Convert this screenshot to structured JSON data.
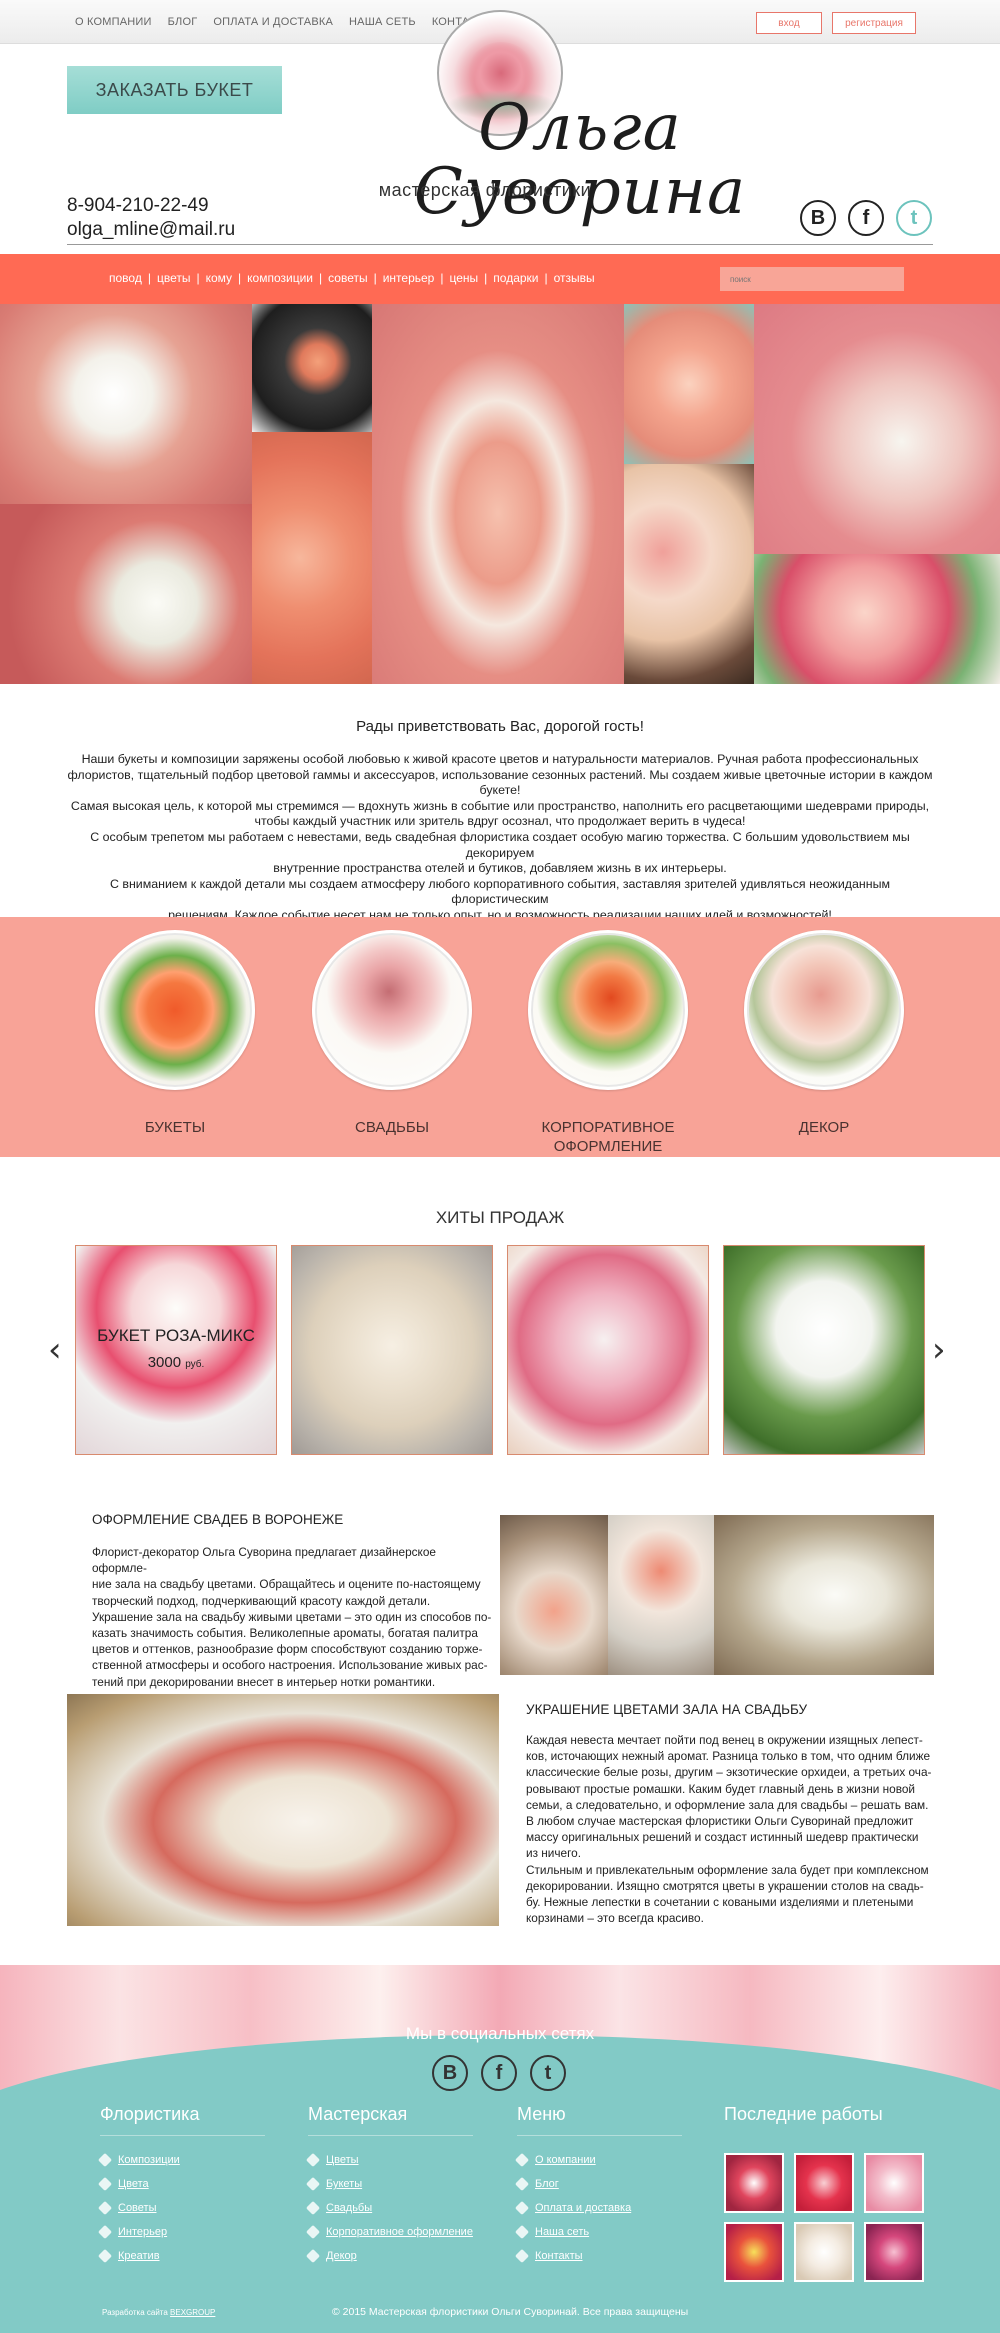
{
  "topnav": [
    "О КОМПАНИИ",
    "БЛОГ",
    "ОПЛАТА И ДОСТАВКА",
    "НАША СЕТЬ",
    "КОНТАКТЫ"
  ],
  "auth": {
    "login": "вход",
    "register": "регистрация"
  },
  "header": {
    "order_button": "ЗАКАЗАТЬ БУКЕТ",
    "logo_name": "Ольга Суворина",
    "logo_sub": "мастерская флористики",
    "phone": "8-904-210-22-49",
    "email": "olga_mline@mail.ru"
  },
  "social": {
    "vk": "В",
    "fb": "f",
    "tw": "t"
  },
  "mainnav": [
    "повод",
    "цветы",
    "кому",
    "композиции",
    "советы",
    "интерьер",
    "цены",
    "подарки",
    "отзывы"
  ],
  "search": {
    "placeholder": "поиск"
  },
  "welcome": {
    "title": "Рады приветствовать Вас, дорогой гость!",
    "lines": [
      "Наши букеты и композиции заряжены особой любовью к живой красоте цветов и натуральности материалов. Ручная работа профессиональных",
      "флористов, тщательный подбор цветовой гаммы и аксессуаров, использование сезонных растений. Мы создаем живые цветочные истории в каждом",
      "букете!",
      "Самая высокая цель, к которой мы стремимся — вдохнуть жизнь в событие или пространство, наполнить его расцветающими шедеврами природы,",
      "чтобы каждый участник или зритель вдруг осознал, что продолжает верить в чудеса!",
      "С особым трепетом мы работаем с невестами, ведь свадебная флористика создает особую магию торжества. С большим удовольствием мы декорируем",
      "внутренние пространства отелей и бутиков, добавляем жизнь в их интерьеры.",
      "С вниманием к каждой детали мы создаем атмосферу любого корпоративного события, заставляя зрителей удивляться неожиданным флористическим",
      "решениям. Каждое событие несет нам не только опыт, но и возможность реализации наших идей и возможностей!"
    ]
  },
  "categories": [
    {
      "label": "БУКЕТЫ"
    },
    {
      "label": "СВАДЬБЫ"
    },
    {
      "label": "КОРПОРАТИВНОЕ ОФОРМЛЕНИЕ"
    },
    {
      "label": "ДЕКОР"
    }
  ],
  "hits": {
    "title": "ХИТЫ ПРОДАЖ",
    "featured_name": "БУКЕТ РОЗА-МИКС",
    "featured_price": "3000",
    "featured_currency": "руб."
  },
  "article1": {
    "title": "ОФОРМЛЕНИЕ СВАДЕБ В ВОРОНЕЖЕ",
    "lines": [
      "Флорист-декоратор Ольга Суворина предлагает дизайнерское оформле-",
      "ние зала на свадьбу цветами. Обращайтесь и оцените по-настоящему",
      "творческий подход, подчеркивающий красоту каждой детали.",
      "Украшение зала на свадьбу живыми цветами – это один из способов по-",
      "казать значимость события. Великолепные ароматы, богатая палитра",
      "цветов и оттенков, разнообразие форм способствуют созданию торже-",
      "ственной атмосферы и особого настроения. Использование живых рас-",
      "тений при декорировании внесет в интерьер нотки романтики."
    ]
  },
  "article2": {
    "title": "УКРАШЕНИЕ ЦВЕТАМИ ЗАЛА НА СВАДЬБУ",
    "lines": [
      "Каждая невеста мечтает пойти под венец в окружении изящных лепест-",
      "ков, источающих нежный аромат. Разница только в том, что одним ближе",
      "классические белые розы, другим – экзотические орхидеи, а третьих оча-",
      "ровывают простые ромашки. Каким будет главный день в жизни новой",
      "семьи, а следовательно, и оформление зала для свадьбы – решать вам.",
      "В любом случае мастерская флористики Ольги Суворинай предложит",
      "массу оригинальных решений и создаст истинный шедевр практически",
      "из ничего.",
      "Стильным и привлекательным оформление зала будет при комплексном",
      "декорировании. Изящно смотрятся цветы в украшении столов на свадь-",
      "бу. Нежные лепестки в сочетании с коваными изделиями и плетеными",
      "корзинами – это всегда красиво."
    ]
  },
  "footer": {
    "social_title": "Мы в социальных сетях",
    "columns": [
      {
        "title": "Флористика",
        "links": [
          "Композиции",
          "Цвета",
          "Советы",
          "Интерьер",
          "Креатив"
        ]
      },
      {
        "title": "Мастерская",
        "links": [
          "Цветы",
          "Букеты",
          "Свадьбы",
          "Корпоративное оформление",
          "Декор"
        ]
      },
      {
        "title": "Меню",
        "links": [
          "О компании",
          "Блог",
          "Оплата и доставка",
          "Наша сеть",
          "Контакты"
        ]
      }
    ],
    "recent_title": "Последние работы",
    "dev_prefix": "Разработка сайта",
    "dev_link": "BEXGROUP",
    "copyright": "© 2015 Мастерская флористики Ольги Суворинай. Все права защищены"
  },
  "colors": {
    "coral": "#ff6a54",
    "salmon": "#f8a397",
    "mint": "#82cac6"
  }
}
